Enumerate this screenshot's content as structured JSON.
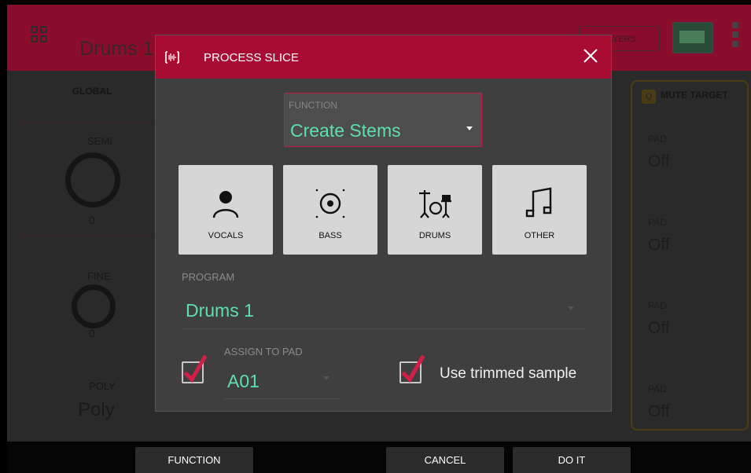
{
  "background": {
    "program_title": "Drums 1",
    "layers_label": "LAYERS",
    "global_label": "GLOBAL",
    "semi_label": "SEMI",
    "semi_value": "0",
    "fine_label": "FINE",
    "fine_value": "0",
    "poly_label": "POLY",
    "poly_value": "Poly",
    "mute_target_label": "MUTE TARGET",
    "mute_q": "Q",
    "pad_label": "PAD",
    "pads": [
      "Off",
      "Off",
      "Off",
      "Off"
    ]
  },
  "modal": {
    "title": "PROCESS SLICE",
    "function_label": "FUNCTION",
    "function_value": "Create Stems",
    "stems": [
      {
        "label": "VOCALS",
        "icon": "person-icon"
      },
      {
        "label": "BASS",
        "icon": "speaker-icon"
      },
      {
        "label": "DRUMS",
        "icon": "drum-kit-icon"
      },
      {
        "label": "OTHER",
        "icon": "music-note-icon"
      }
    ],
    "program_label": "PROGRAM",
    "program_value": "Drums 1",
    "assign_label": "ASSIGN TO PAD",
    "assign_value": "A01",
    "assign_checked": true,
    "trimmed_label": "Use trimmed sample",
    "trimmed_checked": true
  },
  "bottom": {
    "function": "FUNCTION",
    "cancel": "CANCEL",
    "do_it": "DO IT"
  },
  "colors": {
    "header": "#a80c33",
    "accent_green": "#5ee0ad",
    "check_red": "#d31f48"
  }
}
